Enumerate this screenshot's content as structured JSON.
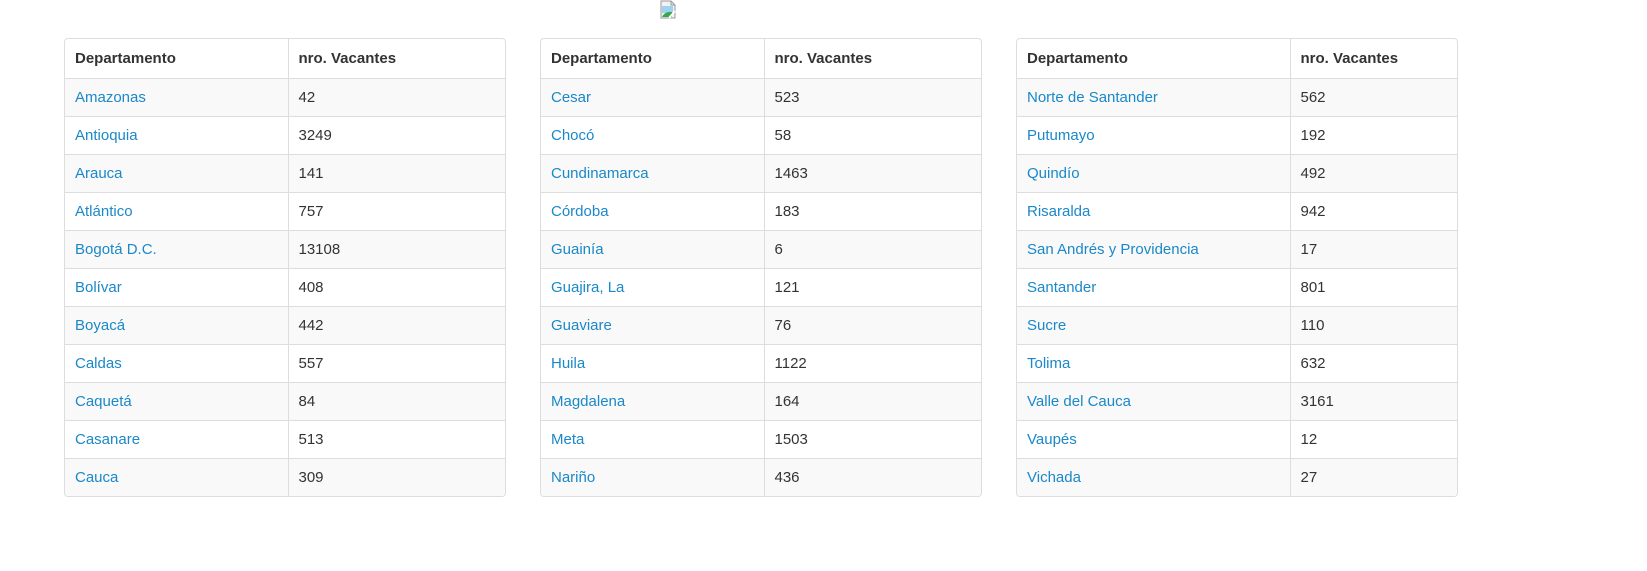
{
  "image": {
    "icon": "broken-image-icon"
  },
  "columns": {
    "department": "Departamento",
    "vacancies": "nro. Vacantes"
  },
  "colors": {
    "link": "#1a88c9",
    "border": "#dddddd",
    "stripe": "#f9f9f9",
    "text": "#333333"
  },
  "tables": [
    {
      "rows": [
        {
          "department": "Amazonas",
          "vacancies": "42"
        },
        {
          "department": "Antioquia",
          "vacancies": "3249"
        },
        {
          "department": "Arauca",
          "vacancies": "141"
        },
        {
          "department": "Atlántico",
          "vacancies": "757"
        },
        {
          "department": "Bogotá D.C.",
          "vacancies": "13108"
        },
        {
          "department": "Bolívar",
          "vacancies": "408"
        },
        {
          "department": "Boyacá",
          "vacancies": "442"
        },
        {
          "department": "Caldas",
          "vacancies": "557"
        },
        {
          "department": "Caquetá",
          "vacancies": "84"
        },
        {
          "department": "Casanare",
          "vacancies": "513"
        },
        {
          "department": "Cauca",
          "vacancies": "309"
        }
      ]
    },
    {
      "rows": [
        {
          "department": "Cesar",
          "vacancies": "523"
        },
        {
          "department": "Chocó",
          "vacancies": "58"
        },
        {
          "department": "Cundinamarca",
          "vacancies": "1463"
        },
        {
          "department": "Córdoba",
          "vacancies": "183"
        },
        {
          "department": "Guainía",
          "vacancies": "6"
        },
        {
          "department": "Guajira, La",
          "vacancies": "121"
        },
        {
          "department": "Guaviare",
          "vacancies": "76"
        },
        {
          "department": "Huila",
          "vacancies": "1122"
        },
        {
          "department": "Magdalena",
          "vacancies": "164"
        },
        {
          "department": "Meta",
          "vacancies": "1503"
        },
        {
          "department": "Nariño",
          "vacancies": "436"
        }
      ]
    },
    {
      "rows": [
        {
          "department": "Norte de Santander",
          "vacancies": "562"
        },
        {
          "department": "Putumayo",
          "vacancies": "192"
        },
        {
          "department": "Quindío",
          "vacancies": "492"
        },
        {
          "department": "Risaralda",
          "vacancies": "942"
        },
        {
          "department": "San Andrés y Providencia",
          "vacancies": "17"
        },
        {
          "department": "Santander",
          "vacancies": "801"
        },
        {
          "department": "Sucre",
          "vacancies": "110"
        },
        {
          "department": "Tolima",
          "vacancies": "632"
        },
        {
          "department": "Valle del Cauca",
          "vacancies": "3161"
        },
        {
          "department": "Vaupés",
          "vacancies": "12"
        },
        {
          "department": "Vichada",
          "vacancies": "27"
        }
      ]
    }
  ]
}
